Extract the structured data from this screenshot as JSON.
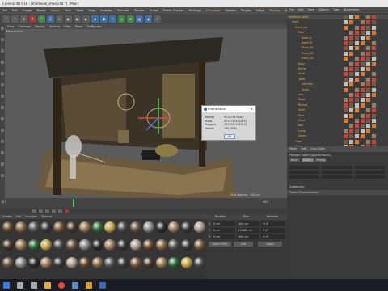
{
  "window": {
    "title": "Cinema 4D R18 - [medieval_shed.c4d *] - Main"
  },
  "menubar": {
    "items": [
      "File",
      "Edit",
      "Create",
      "Modes",
      "Select",
      "Tools",
      "Mesh",
      "Snap",
      "Animate",
      "Simulate",
      "Render",
      "Sculpt",
      "Motion Tracker",
      "MoGraph",
      "Character",
      "Pipeline",
      "Plugins",
      "Script",
      "Window",
      "Help"
    ],
    "highlighted": [
      4,
      14,
      18
    ]
  },
  "toolbar": {
    "buttons": [
      "↶",
      "↷",
      "✥",
      "X",
      "Y",
      "Z",
      "L",
      "▶",
      "▶",
      "▶",
      "◆",
      "⬢",
      "✎",
      "◎",
      "❀",
      "▦",
      "◉",
      "☀"
    ]
  },
  "viewport": {
    "menu": [
      "View",
      "Cameras",
      "Display",
      "Options",
      "Filter",
      "Panel",
      "ProRender"
    ],
    "label": "Perspective",
    "grid_spacing": "Grid Spacing : 100 cm"
  },
  "dialog": {
    "title": "Information",
    "rows": [
      {
        "k": "Meshes",
        "v": "91 (8754 M&M)"
      },
      {
        "k": "Points",
        "v": "271473 (282154)"
      },
      {
        "k": "Polygons",
        "v": "187933 (194710)"
      },
      {
        "k": "Objects",
        "v": "165 (306)"
      }
    ],
    "ok_label": "OK"
  },
  "objects": {
    "menu": [
      "File",
      "Edit",
      "View",
      "Objects",
      "Tags",
      "Bookmarks"
    ],
    "rows": [
      "medieval shed",
      "Shed",
      "Shed_old",
      "Roof",
      "Beam_L",
      "Beam_R",
      "Plank_01",
      "Plank_02",
      "Plank_03",
      "Door",
      "Barrel",
      "Anvil",
      "Tools",
      "Hammer",
      "Chain",
      "Hay",
      "Rope",
      "Bucket",
      "Shelf",
      "Pole",
      "Stool",
      "Box",
      "Lamp",
      "Sacks",
      "Floor",
      "Grass"
    ]
  },
  "attributes": {
    "menu": [
      "Mode",
      "Edit",
      "User Data"
    ],
    "title": "Polygon Object [polySurface1]",
    "tabs": [
      "Basic",
      "Coord.",
      "Phong"
    ],
    "section1": "Quaternion",
    "section2": "Freeze Transformation"
  },
  "materials": {
    "menu": [
      "Create",
      "Edit",
      "Function",
      "Texture"
    ]
  },
  "coords": {
    "headers": [
      "Position",
      "Size",
      "Rotation"
    ],
    "rows": [
      {
        "a": "X",
        "p": "0 cm",
        "s": "400 cm",
        "r": "H 0°"
      },
      {
        "a": "Y",
        "p": "0 cm",
        "s": "12.089 cm",
        "r": "P 0°"
      },
      {
        "a": "Z",
        "p": "0 cm",
        "s": "400 cm",
        "r": "B 0°"
      }
    ],
    "mode": "Object (Rel)",
    "size_mode": "Size",
    "apply": "Apply"
  },
  "timeline": {
    "frame": "0 F",
    "end": "90 F"
  },
  "taskbar": {
    "icons": [
      "start-icon",
      "search-icon",
      "taskview-icon",
      "explorer-icon",
      "chrome-icon",
      "c4d-icon",
      "files-icon",
      "photoshop-icon"
    ]
  }
}
